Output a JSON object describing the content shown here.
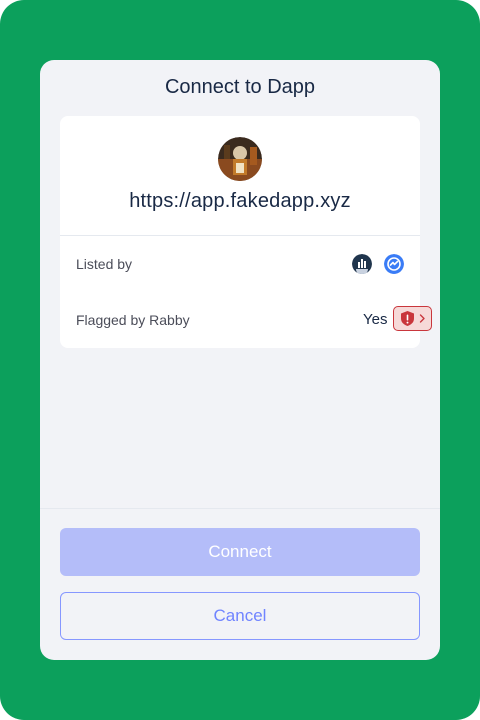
{
  "title": "Connect to Dapp",
  "dapp": {
    "url": "https://app.fakedapp.xyz",
    "logo_icon": "dapp-avatar-image"
  },
  "rows": {
    "listed_by": {
      "label": "Listed by",
      "icons": [
        "defillama-icon",
        "coingecko-icon"
      ]
    },
    "flagged_by": {
      "label": "Flagged by Rabby",
      "value": "Yes",
      "badge_icon": "warning-shield-icon"
    }
  },
  "buttons": {
    "connect": "Connect",
    "cancel": "Cancel"
  },
  "colors": {
    "background": "#0ca05c",
    "danger": "#c9363c",
    "primary": "#7084ff",
    "primary_disabled": "#b4bdf9"
  }
}
